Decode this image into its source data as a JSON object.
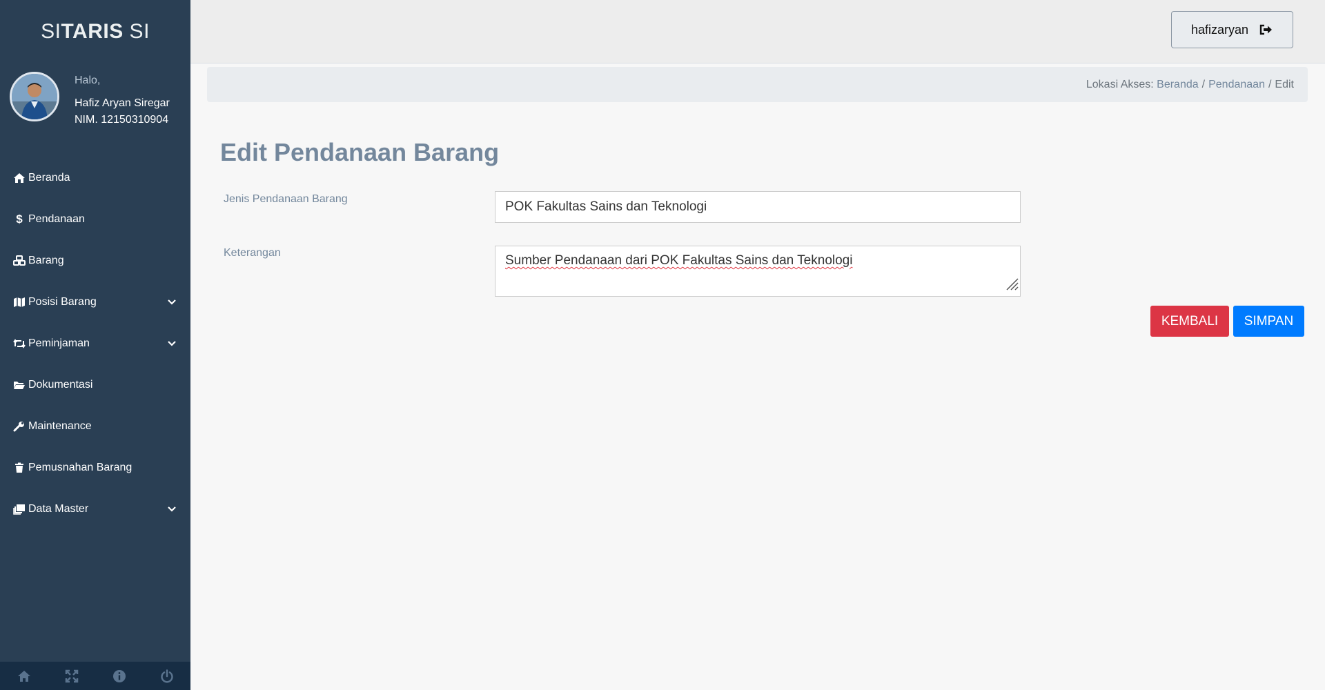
{
  "brand": {
    "part1": "SI",
    "part2": "TARIS",
    "part3": " SI"
  },
  "profile": {
    "greeting": "Halo,",
    "name": "Hafiz Aryan Siregar",
    "nim": "NIM. 12150310904"
  },
  "sidebar": {
    "items": [
      {
        "label": "Beranda",
        "icon": "home-icon"
      },
      {
        "label": "Pendanaan",
        "icon": "dollar-icon"
      },
      {
        "label": "Barang",
        "icon": "cubes-icon"
      },
      {
        "label": "Posisi Barang",
        "icon": "map-icon",
        "expandable": true
      },
      {
        "label": "Peminjaman",
        "icon": "retweet-icon",
        "expandable": true
      },
      {
        "label": "Dokumentasi",
        "icon": "folder-open-icon"
      },
      {
        "label": "Maintenance",
        "icon": "wrench-icon"
      },
      {
        "label": "Pemusnahan Barang",
        "icon": "trash-icon"
      },
      {
        "label": "Data Master",
        "icon": "clone-icon",
        "expandable": true
      }
    ],
    "footer_icons": [
      "home-icon",
      "fullscreen-icon",
      "info-icon",
      "power-icon"
    ]
  },
  "topnav": {
    "username": "hafizaryan",
    "icon": "sign-out-icon"
  },
  "breadcrumb": {
    "prefix": "Lokasi Akses: ",
    "items": [
      "Beranda",
      "Pendanaan",
      "Edit"
    ]
  },
  "page": {
    "title": "Edit Pendanaan Barang"
  },
  "form": {
    "jenis_label": "Jenis Pendanaan Barang",
    "jenis_value": "POK Fakultas Sains dan Teknologi",
    "keterangan_label": "Keterangan",
    "keterangan_value": "Sumber Pendanaan dari POK Fakultas Sains dan Teknologi"
  },
  "buttons": {
    "back": "KEMBALI",
    "save": "SIMPAN"
  },
  "colors": {
    "sidebar_bg": "#2a3f54",
    "footer_bg": "#172d44",
    "title": "#73879c",
    "danger": "#dc3545",
    "primary": "#007bff"
  }
}
